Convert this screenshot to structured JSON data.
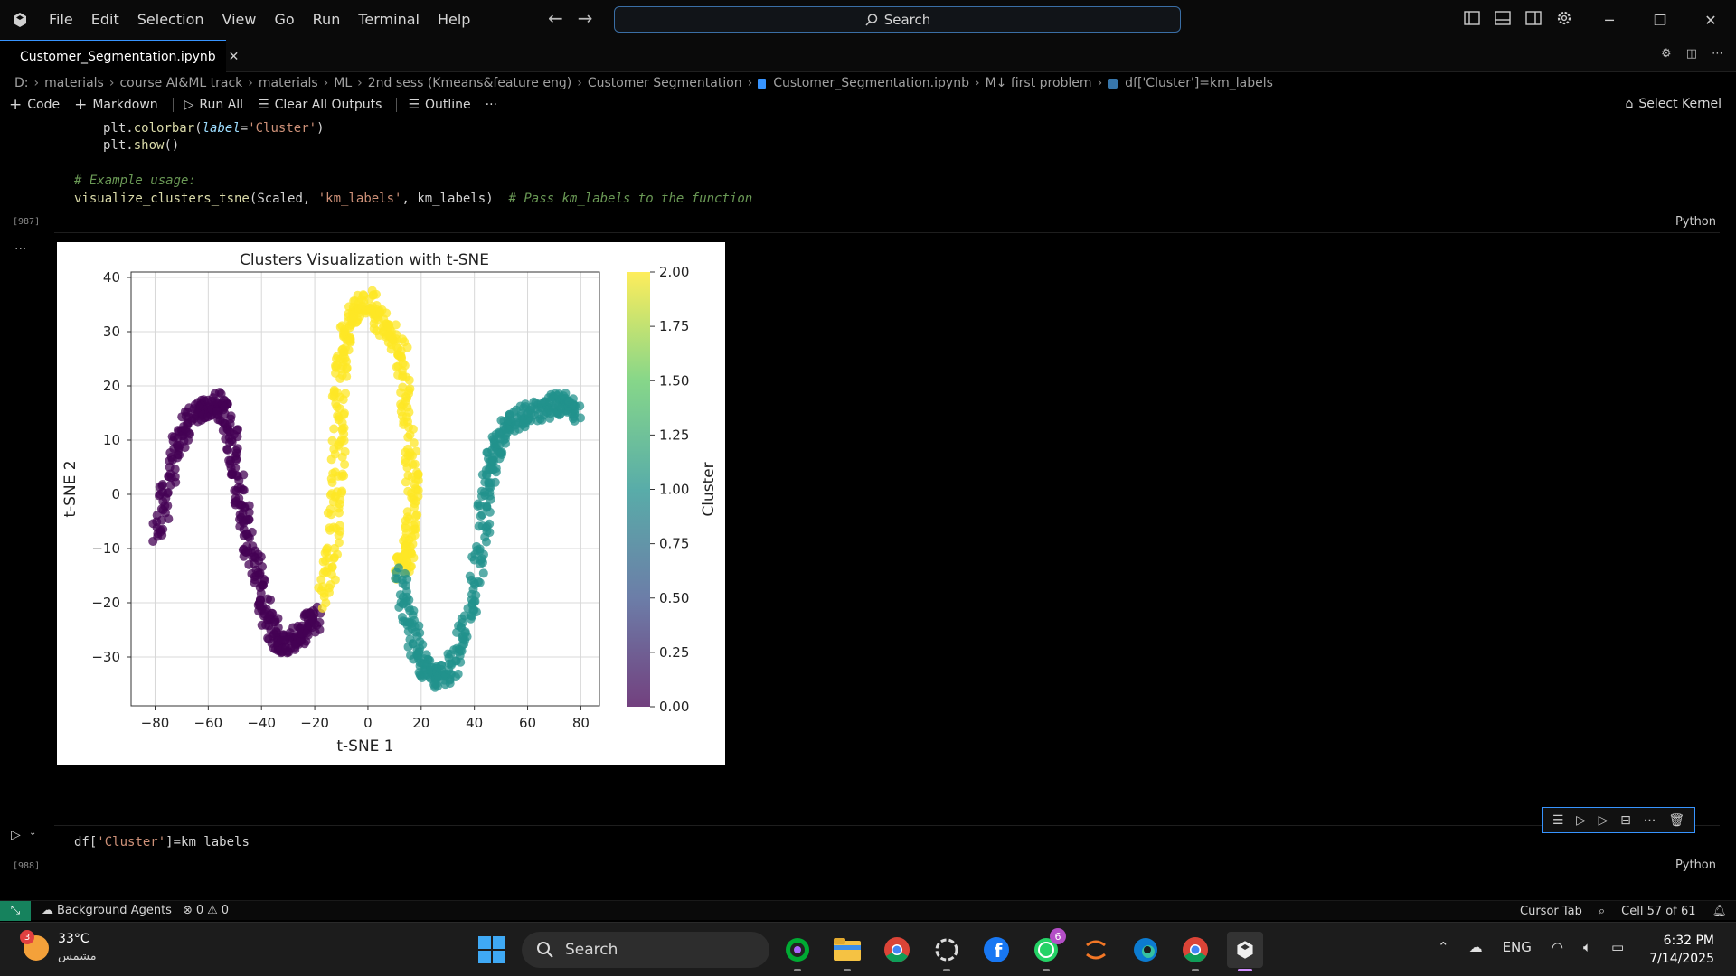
{
  "menu": [
    "File",
    "Edit",
    "Selection",
    "View",
    "Go",
    "Run",
    "Terminal",
    "Help"
  ],
  "command_search": {
    "label": "Search"
  },
  "tab": {
    "label": "Customer_Segmentation.ipynb"
  },
  "breadcrumb": [
    "D:",
    "materials",
    "course AI&ML track",
    "materials",
    "ML",
    "2nd sess (Kmeans&feature eng)",
    "Customer Segmentation",
    "Customer_Segmentation.ipynb",
    "M↓ first problem",
    "df['Cluster']=km_labels"
  ],
  "toolbar": {
    "code": "Code",
    "markdown": "Markdown",
    "run_all": "Run All",
    "clear_outputs": "Clear All Outputs",
    "outline": "Outline",
    "more": "···",
    "select_kernel": "Select Kernel"
  },
  "cell1": {
    "line1": {
      "obj": "plt",
      "fn": "colorbar",
      "param": "label",
      "str": "'Cluster'"
    },
    "line2": {
      "obj": "plt",
      "fn": "show"
    },
    "comment": "# Example usage:",
    "call": {
      "fn": "visualize_clusters_tsne",
      "arg1": "Scaled",
      "arg2": "'km_labels'",
      "arg3": "km_labels",
      "comment": "# Pass km_labels to the function"
    },
    "exec_count": "[987]",
    "lang": "Python"
  },
  "output_menu": "···",
  "chart_data": {
    "type": "scatter",
    "title": "Clusters Visualization with t-SNE",
    "xlabel": "t-SNE 1",
    "ylabel": "t-SNE 2",
    "xlim": [
      -89,
      87
    ],
    "ylim": [
      -39,
      41
    ],
    "xticks": [
      "−80",
      "−60",
      "−40",
      "−20",
      "0",
      "20",
      "40",
      "60",
      "80"
    ],
    "xtick_values": [
      -80,
      -60,
      -40,
      -20,
      0,
      20,
      40,
      60,
      80
    ],
    "yticks": [
      "40",
      "30",
      "20",
      "10",
      "0",
      "−10",
      "−20",
      "−30"
    ],
    "ytick_values": [
      40,
      30,
      20,
      10,
      0,
      -10,
      -20,
      -30
    ],
    "grid": true,
    "colorbar": {
      "label": "Cluster",
      "range": [
        0,
        2
      ],
      "ticks": [
        "2.00",
        "1.75",
        "1.50",
        "1.25",
        "1.00",
        "0.75",
        "0.50",
        "0.25",
        "0.00"
      ],
      "tick_values": [
        2.0,
        1.75,
        1.5,
        1.25,
        1.0,
        0.75,
        0.5,
        0.25,
        0.0
      ],
      "colors": [
        "#440154",
        "#3b528b",
        "#21918c",
        "#5ec962",
        "#fde725"
      ]
    },
    "series": [
      {
        "cluster": 0,
        "color": "#440154",
        "path_x": [
          -79,
          -76,
          -72,
          -68,
          -64,
          -60,
          -56,
          -53,
          -50,
          -48,
          -46,
          -43,
          -40,
          -37,
          -34,
          -30,
          -26,
          -22,
          -19
        ],
        "path_y": [
          -8,
          0,
          8,
          13,
          15,
          16,
          17,
          14,
          8,
          0,
          -6,
          -12,
          -18,
          -24,
          -27,
          -28,
          -26,
          -24,
          -22
        ]
      },
      {
        "cluster": 2,
        "color": "#fde725",
        "path_x": [
          -17,
          -14,
          -12,
          -11,
          -11,
          -10,
          -8,
          -4,
          0,
          4,
          8,
          12,
          14,
          16,
          17,
          16,
          14,
          12
        ],
        "path_y": [
          -20,
          -12,
          -2,
          8,
          18,
          26,
          30,
          34,
          36,
          33,
          30,
          27,
          18,
          8,
          0,
          -8,
          -12,
          -14
        ]
      },
      {
        "cluster": 1,
        "color": "#21918c",
        "path_x": [
          12,
          15,
          18,
          22,
          26,
          30,
          34,
          38,
          42,
          44,
          46,
          48,
          52,
          56,
          62,
          68,
          72,
          76,
          78
        ],
        "path_y": [
          -15,
          -22,
          -28,
          -32,
          -34,
          -33,
          -28,
          -22,
          -12,
          -2,
          4,
          8,
          12,
          14,
          15,
          16,
          17,
          16,
          15
        ]
      }
    ]
  },
  "cell2": {
    "code": {
      "obj": "df",
      "str": "'Cluster'",
      "rest": "]=km_labels"
    },
    "exec_count": "[988]",
    "lang": "Python"
  },
  "status": {
    "agents": "Background Agents",
    "errors": "0",
    "warnings": "0",
    "cursor_tab": "Cursor Tab",
    "cell_pos": "Cell 57 of 61"
  },
  "taskbar": {
    "weather_temp": "33°C",
    "weather_desc": "مشمس",
    "weather_badge": "3",
    "search": "Search",
    "whatsapp_badge": "6",
    "lang": "ENG",
    "time": "6:32 PM",
    "date": "7/14/2025"
  }
}
